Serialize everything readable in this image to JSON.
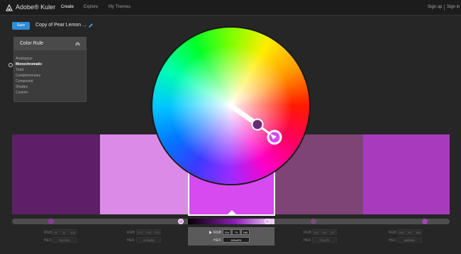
{
  "app": {
    "title": "Adobe® Kuler"
  },
  "nav": [
    {
      "label": "Create"
    },
    {
      "label": "Explore"
    },
    {
      "label": "My Themes"
    }
  ],
  "auth": {
    "sign_up": "Sign up",
    "sign_in": "Sign in"
  },
  "toolbar": {
    "save_label": "Save",
    "theme_name": "Copy of Pear Lemon ..."
  },
  "color_rule": {
    "title": "Color Rule",
    "selected": "Monochromatic",
    "options": [
      "Analogous",
      "Monochromatic",
      "Triad",
      "Complementary",
      "Compound",
      "Shades",
      "Custom"
    ]
  },
  "swatches": [
    {
      "hex": "5E1F68",
      "rgb": [
        "94",
        "31",
        "104"
      ]
    },
    {
      "hex": "DC8AE8",
      "rgb": [
        "220",
        "138",
        "232"
      ]
    },
    {
      "hex": "D64AF0",
      "rgb": [
        "214",
        "74",
        "240"
      ]
    },
    {
      "hex": "7D4475",
      "rgb": [
        "125",
        "68",
        "117"
      ]
    },
    {
      "hex": "A83BBD",
      "rgb": [
        "168",
        "59",
        "189"
      ]
    }
  ],
  "active_swatch": 2,
  "labels": {
    "rgb": "RGB",
    "hex": "HEX"
  },
  "colors": {
    "accent": "#2d8ed8",
    "wheel_marker": "#6b2a74"
  },
  "icons": [
    "kuler-logo-icon",
    "pencil-icon",
    "collapse-icon",
    "radio-icon",
    "play-icon"
  ]
}
